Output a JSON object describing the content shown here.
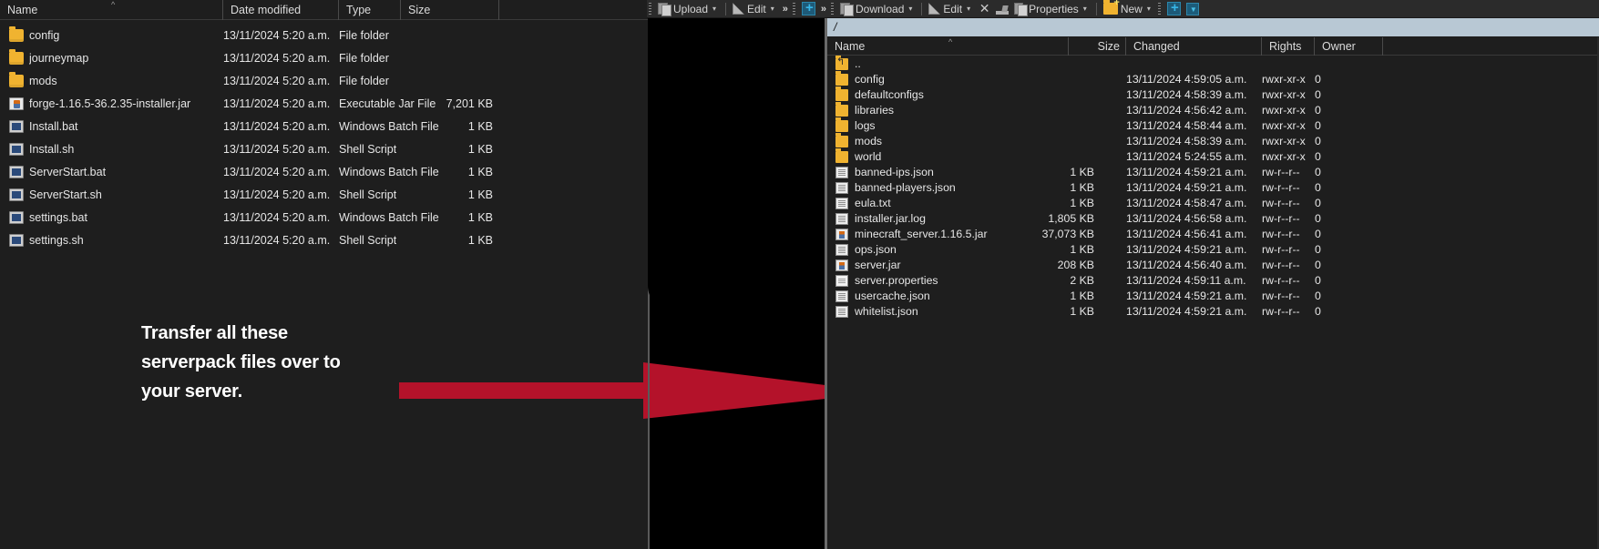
{
  "left_pane": {
    "name": "windows-explorer-pane",
    "columns": [
      {
        "label": "Name",
        "sorted": true,
        "sort_glyph": "^"
      },
      {
        "label": "Date modified"
      },
      {
        "label": "Type"
      },
      {
        "label": "Size"
      }
    ],
    "rows": [
      {
        "icon": "folder-icon",
        "name": "config",
        "date": "13/11/2024 5:20 a.m.",
        "type": "File folder",
        "size": ""
      },
      {
        "icon": "folder-icon",
        "name": "journeymap",
        "date": "13/11/2024 5:20 a.m.",
        "type": "File folder",
        "size": ""
      },
      {
        "icon": "folder-icon",
        "name": "mods",
        "date": "13/11/2024 5:20 a.m.",
        "type": "File folder",
        "size": ""
      },
      {
        "icon": "jar-file-icon",
        "name": "forge-1.16.5-36.2.35-installer.jar",
        "date": "13/11/2024 5:20 a.m.",
        "type": "Executable Jar File",
        "size": "7,201 KB"
      },
      {
        "icon": "script-file-icon",
        "name": "Install.bat",
        "date": "13/11/2024 5:20 a.m.",
        "type": "Windows Batch File",
        "size": "1 KB"
      },
      {
        "icon": "script-file-icon",
        "name": "Install.sh",
        "date": "13/11/2024 5:20 a.m.",
        "type": "Shell Script",
        "size": "1 KB"
      },
      {
        "icon": "script-file-icon",
        "name": "ServerStart.bat",
        "date": "13/11/2024 5:20 a.m.",
        "type": "Windows Batch File",
        "size": "1 KB"
      },
      {
        "icon": "script-file-icon",
        "name": "ServerStart.sh",
        "date": "13/11/2024 5:20 a.m.",
        "type": "Shell Script",
        "size": "1 KB"
      },
      {
        "icon": "script-file-icon",
        "name": "settings.bat",
        "date": "13/11/2024 5:20 a.m.",
        "type": "Windows Batch File",
        "size": "1 KB"
      },
      {
        "icon": "script-file-icon",
        "name": "settings.sh",
        "date": "13/11/2024 5:20 a.m.",
        "type": "Shell Script",
        "size": "1 KB"
      }
    ]
  },
  "annotation": {
    "line1": "Transfer all these",
    "line2": "serverpack files over to",
    "line3": "your server.",
    "arrow_color": "#b4122a",
    "text_color": "#ffffff"
  },
  "right_pane": {
    "name": "winscp-remote-pane",
    "toolbar": [
      {
        "id": "grip-1",
        "type": "grip"
      },
      {
        "id": "upload",
        "type": "button",
        "icon": "copy-icon",
        "label": "Upload",
        "caret": "▾"
      },
      {
        "id": "sep-1",
        "type": "sep"
      },
      {
        "id": "edit-local",
        "type": "button",
        "icon": "edit-icon",
        "label": "Edit",
        "caret": "▾"
      },
      {
        "id": "overflow-1",
        "type": "chevron",
        "label": "»"
      },
      {
        "id": "grip-2",
        "type": "grip"
      },
      {
        "id": "new-local",
        "type": "button",
        "icon": "plus-icon",
        "label": "",
        "caret": ""
      },
      {
        "id": "overflow-2",
        "type": "chevron",
        "label": "»"
      },
      {
        "id": "grip-3",
        "type": "grip"
      },
      {
        "id": "download",
        "type": "button",
        "icon": "copy-icon",
        "label": "Download",
        "caret": "▾"
      },
      {
        "id": "sep-2",
        "type": "sep"
      },
      {
        "id": "edit-remote",
        "type": "button",
        "icon": "edit-icon",
        "label": "Edit",
        "caret": "▾"
      },
      {
        "id": "delete",
        "type": "button",
        "icon": "close-x-icon",
        "label": "",
        "caret": ""
      },
      {
        "id": "permissions",
        "type": "button",
        "icon": "permissions-icon",
        "label": "",
        "caret": ""
      },
      {
        "id": "properties",
        "type": "button",
        "icon": "properties-icon",
        "label": "Properties",
        "caret": "▾"
      },
      {
        "id": "sep-3",
        "type": "sep"
      },
      {
        "id": "new-remote",
        "type": "button",
        "icon": "new-folder-icon",
        "label": "New",
        "caret": "▾"
      },
      {
        "id": "grip-4",
        "type": "grip"
      },
      {
        "id": "add",
        "type": "button",
        "icon": "plus-icon",
        "label": "",
        "caret": ""
      },
      {
        "id": "filter",
        "type": "button",
        "icon": "filter-icon",
        "label": "",
        "caret": ""
      }
    ],
    "path": "/",
    "columns": [
      {
        "label": "Name",
        "sorted": true,
        "sort_glyph": "^"
      },
      {
        "label": "Size"
      },
      {
        "label": "Changed"
      },
      {
        "label": "Rights"
      },
      {
        "label": "Owner"
      }
    ],
    "rows": [
      {
        "icon": "parent-folder-icon",
        "name": "..",
        "size": "",
        "changed": "",
        "rights": "",
        "owner": ""
      },
      {
        "icon": "folder-icon",
        "name": "config",
        "size": "",
        "changed": "13/11/2024 4:59:05 a.m.",
        "rights": "rwxr-xr-x",
        "owner": "0"
      },
      {
        "icon": "folder-icon",
        "name": "defaultconfigs",
        "size": "",
        "changed": "13/11/2024 4:58:39 a.m.",
        "rights": "rwxr-xr-x",
        "owner": "0"
      },
      {
        "icon": "folder-icon",
        "name": "libraries",
        "size": "",
        "changed": "13/11/2024 4:56:42 a.m.",
        "rights": "rwxr-xr-x",
        "owner": "0"
      },
      {
        "icon": "folder-icon",
        "name": "logs",
        "size": "",
        "changed": "13/11/2024 4:58:44 a.m.",
        "rights": "rwxr-xr-x",
        "owner": "0"
      },
      {
        "icon": "folder-icon",
        "name": "mods",
        "size": "",
        "changed": "13/11/2024 4:58:39 a.m.",
        "rights": "rwxr-xr-x",
        "owner": "0"
      },
      {
        "icon": "folder-icon",
        "name": "world",
        "size": "",
        "changed": "13/11/2024 5:24:55 a.m.",
        "rights": "rwxr-xr-x",
        "owner": "0"
      },
      {
        "icon": "json-file-icon",
        "name": "banned-ips.json",
        "size": "1 KB",
        "changed": "13/11/2024 4:59:21 a.m.",
        "rights": "rw-r--r--",
        "owner": "0"
      },
      {
        "icon": "json-file-icon",
        "name": "banned-players.json",
        "size": "1 KB",
        "changed": "13/11/2024 4:59:21 a.m.",
        "rights": "rw-r--r--",
        "owner": "0"
      },
      {
        "icon": "json-file-icon",
        "name": "eula.txt",
        "size": "1 KB",
        "changed": "13/11/2024 4:58:47 a.m.",
        "rights": "rw-r--r--",
        "owner": "0"
      },
      {
        "icon": "json-file-icon",
        "name": "installer.jar.log",
        "size": "1,805 KB",
        "changed": "13/11/2024 4:56:58 a.m.",
        "rights": "rw-r--r--",
        "owner": "0"
      },
      {
        "icon": "jar-file-icon",
        "name": "minecraft_server.1.16.5.jar",
        "size": "37,073 KB",
        "changed": "13/11/2024 4:56:41 a.m.",
        "rights": "rw-r--r--",
        "owner": "0"
      },
      {
        "icon": "json-file-icon",
        "name": "ops.json",
        "size": "1 KB",
        "changed": "13/11/2024 4:59:21 a.m.",
        "rights": "rw-r--r--",
        "owner": "0"
      },
      {
        "icon": "jar-file-icon",
        "name": "server.jar",
        "size": "208 KB",
        "changed": "13/11/2024 4:56:40 a.m.",
        "rights": "rw-r--r--",
        "owner": "0"
      },
      {
        "icon": "plain-file-icon",
        "name": "server.properties",
        "size": "2 KB",
        "changed": "13/11/2024 4:59:11 a.m.",
        "rights": "rw-r--r--",
        "owner": "0"
      },
      {
        "icon": "json-file-icon",
        "name": "usercache.json",
        "size": "1 KB",
        "changed": "13/11/2024 4:59:21 a.m.",
        "rights": "rw-r--r--",
        "owner": "0"
      },
      {
        "icon": "json-file-icon",
        "name": "whitelist.json",
        "size": "1 KB",
        "changed": "13/11/2024 4:59:21 a.m.",
        "rights": "rw-r--r--",
        "owner": "0"
      }
    ]
  }
}
